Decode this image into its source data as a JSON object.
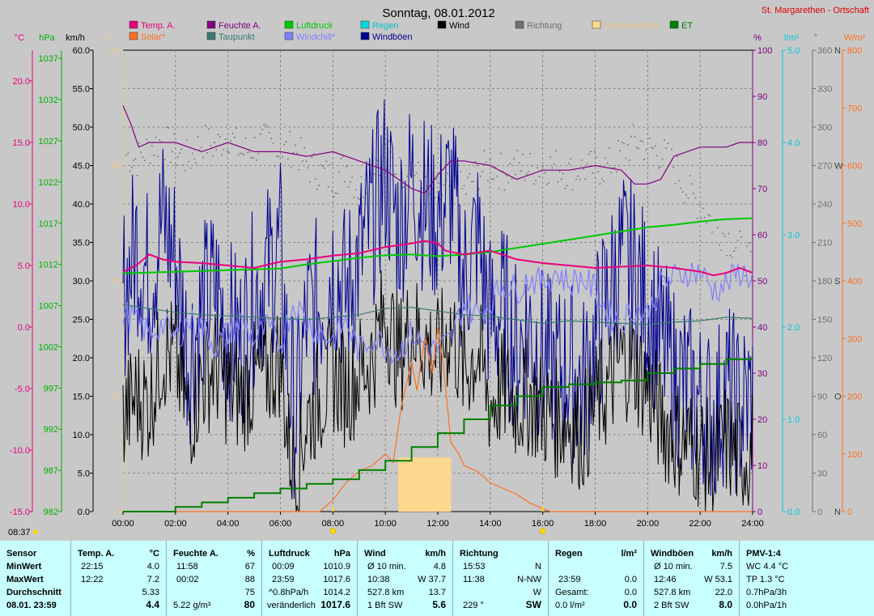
{
  "header": {
    "title": "Sonntag, 08.01.2012",
    "location": "St. Margarethen - Ortschaft",
    "sunrise_time": "08:37"
  },
  "legend": [
    {
      "label": "Temp. A.",
      "color": "#e8007a"
    },
    {
      "label": "Feuchte A.",
      "color": "#800080"
    },
    {
      "label": "Luftdruck",
      "color": "#00c800"
    },
    {
      "label": "Regen",
      "color": "#00d8e0"
    },
    {
      "label": "Wind",
      "color": "#000000"
    },
    {
      "label": "Richtung",
      "color": "#707070"
    },
    {
      "label": "Sonnenschein",
      "color": "#ffd890"
    },
    {
      "label": "ET",
      "color": "#008000"
    },
    {
      "label": "Solar*",
      "color": "#ff7020"
    },
    {
      "label": "Taupunkt",
      "color": "#3a7a70"
    },
    {
      "label": "Windchill*",
      "color": "#8080ff"
    },
    {
      "label": "Windböen",
      "color": "#000090"
    }
  ],
  "axes": {
    "temp": {
      "unit": "°C",
      "ticks": [
        "20.0",
        "15.0",
        "10.0",
        "5.0",
        "0.0",
        "-5.0",
        "-10.0",
        "-15.0"
      ]
    },
    "pressure": {
      "unit": "hPa",
      "ticks": [
        "1037",
        "1032",
        "1027",
        "1022",
        "1017",
        "1012",
        "1007",
        "1002",
        "997",
        "992",
        "987",
        "982"
      ]
    },
    "wind": {
      "unit": "km/h",
      "ticks": [
        "60.0",
        "55.0",
        "50.0",
        "45.0",
        "40.0",
        "35.0",
        "30.0",
        "25.0",
        "20.0",
        "15.0",
        "10.0",
        "5.0",
        "0.0"
      ]
    },
    "sun": {
      "unit": "h",
      "ticks": [
        "60",
        "45",
        "30",
        "15",
        "0"
      ]
    },
    "humidity": {
      "unit": "%",
      "ticks": [
        "100",
        "90",
        "80",
        "70",
        "60",
        "50",
        "40",
        "30",
        "20",
        "10",
        "0"
      ]
    },
    "rain": {
      "unit": "l/m²",
      "ticks": [
        "5.0",
        "4.0",
        "3.0",
        "2.0",
        "1.0",
        "0.0"
      ]
    },
    "direction": {
      "unit": "°",
      "ticks": [
        "360",
        "330",
        "300",
        "270",
        "240",
        "210",
        "180",
        "150",
        "120",
        "90",
        "60",
        "30",
        "0"
      ],
      "compass": [
        "N",
        "",
        "",
        "W",
        "",
        "",
        "S",
        "",
        "",
        "O",
        "",
        "",
        "N"
      ]
    },
    "solar": {
      "unit": "W/m²",
      "ticks": [
        "800",
        "700",
        "600",
        "500",
        "400",
        "300",
        "200",
        "100",
        "0"
      ]
    },
    "x_ticks": [
      "00:00",
      "02:00",
      "04:00",
      "06:00",
      "08:00",
      "10:00",
      "12:00",
      "14:00",
      "16:00",
      "18:00",
      "20:00",
      "22:00",
      "24:00"
    ]
  },
  "chart_data": {
    "type": "line",
    "x_unit": "hours",
    "xlim": [
      0,
      24
    ],
    "grid": true,
    "legend_position": "top",
    "series": [
      {
        "name": "Temp. A.",
        "axis": "temp",
        "color": "#e8007a",
        "x": [
          0,
          0.5,
          1,
          1.5,
          2,
          3,
          4,
          5,
          6,
          7,
          8,
          9,
          10,
          11,
          11.5,
          12,
          12.3,
          13,
          14,
          15,
          16,
          17,
          18,
          19,
          20,
          21,
          22,
          22.5,
          23,
          23.5,
          24
        ],
        "y": [
          4.5,
          5.0,
          5.9,
          5.5,
          5.3,
          5.2,
          5.0,
          4.8,
          5.3,
          5.5,
          5.8,
          6.0,
          6.5,
          6.8,
          7.0,
          6.8,
          6.2,
          5.9,
          6.2,
          5.5,
          5.2,
          5.0,
          4.8,
          4.9,
          5.0,
          4.8,
          4.5,
          4.2,
          4.4,
          4.8,
          4.4
        ]
      },
      {
        "name": "Feuchte A.",
        "axis": "humidity",
        "color": "#800080",
        "x": [
          0,
          0.3,
          0.6,
          1,
          2,
          3,
          4,
          5,
          6,
          7,
          8,
          9,
          10,
          10.5,
          11,
          11.5,
          12,
          12.5,
          13,
          14,
          15,
          16,
          17,
          18,
          19,
          19.5,
          20,
          20.5,
          21,
          22,
          23,
          23.5,
          24
        ],
        "y": [
          88,
          84,
          79,
          80,
          80,
          78,
          80,
          78,
          78,
          77,
          78,
          76,
          74,
          72,
          70,
          69,
          73,
          76,
          76,
          75,
          72,
          74,
          74,
          75,
          74,
          71,
          71,
          72,
          77,
          79,
          79,
          80,
          80
        ]
      },
      {
        "name": "Luftdruck",
        "axis": "pressure",
        "color": "#00c800",
        "x": [
          0,
          1,
          2,
          3,
          4,
          5,
          6,
          7,
          8,
          9,
          10,
          11,
          12,
          13,
          14,
          15,
          16,
          17,
          18,
          19,
          20,
          21,
          22,
          23,
          24
        ],
        "y": [
          1010.9,
          1011.0,
          1011.1,
          1011.2,
          1011.3,
          1011.4,
          1011.5,
          1012.0,
          1012.4,
          1012.8,
          1013.1,
          1013.2,
          1013.0,
          1013.2,
          1013.5,
          1014.0,
          1014.5,
          1015.0,
          1015.5,
          1016.0,
          1016.5,
          1016.8,
          1017.2,
          1017.5,
          1017.6
        ]
      },
      {
        "name": "Taupunkt",
        "axis": "temp",
        "color": "#3a7a70",
        "x": [
          0,
          1,
          2,
          3,
          4,
          5,
          6,
          7,
          8,
          9,
          10,
          11,
          12,
          13,
          14,
          15,
          16,
          17,
          18,
          19,
          20,
          21,
          22,
          23,
          24
        ],
        "y": [
          1.8,
          1.5,
          1.2,
          1.0,
          0.9,
          0.8,
          0.7,
          0.6,
          0.8,
          1.0,
          1.5,
          1.6,
          1.3,
          1.0,
          0.9,
          0.6,
          0.3,
          0.5,
          0.4,
          0.3,
          0.2,
          0.4,
          0.5,
          0.8,
          0.7
        ]
      },
      {
        "name": "Windchill*",
        "axis": "temp",
        "color": "#8080ff",
        "x": [
          0,
          0.5,
          1,
          1.5,
          2,
          2.5,
          3,
          3.5,
          4,
          4.5,
          5,
          5.5,
          6,
          6.5,
          7,
          7.5,
          8,
          8.5,
          9,
          9.5,
          10,
          10.5,
          11,
          11.5,
          12,
          12.5,
          13,
          13.5,
          14,
          14.5,
          15,
          15.5,
          16,
          16.5,
          17,
          17.5,
          18,
          18.5,
          19,
          19.5,
          20,
          20.5,
          21,
          21.5,
          22,
          22.5,
          23,
          23.5,
          24
        ],
        "y": [
          1.2,
          0.5,
          -0.5,
          0.2,
          -1.0,
          0.5,
          0.0,
          -1.5,
          -0.5,
          0.5,
          -1.0,
          0.0,
          -1.5,
          2.0,
          0.5,
          -0.5,
          -1.0,
          0.5,
          -2.0,
          -0.8,
          -1.5,
          -2.0,
          -0.5,
          -1.5,
          -2.0,
          -1.0,
          2.0,
          1.0,
          2.0,
          3.5,
          3.0,
          4.0,
          3.5,
          4.5,
          3.5,
          4.0,
          3.0,
          1.0,
          0.5,
          1.5,
          1.0,
          3.5,
          4.0,
          4.5,
          4.5,
          3.0,
          3.5,
          4.5,
          4.0
        ]
      },
      {
        "name": "Solar*",
        "axis": "solar",
        "color": "#ff7020",
        "x": [
          0,
          7.5,
          8,
          8.5,
          9,
          9.5,
          10,
          10.3,
          10.6,
          11,
          11.2,
          11.5,
          11.8,
          12,
          12.2,
          12.5,
          12.8,
          13,
          13.5,
          14,
          14.5,
          15,
          15.5,
          16,
          16.3,
          16.8,
          24
        ],
        "y": [
          0,
          0,
          20,
          50,
          70,
          80,
          100,
          85,
          180,
          260,
          210,
          300,
          240,
          320,
          260,
          120,
          100,
          80,
          70,
          50,
          40,
          30,
          15,
          5,
          0,
          0,
          0
        ]
      },
      {
        "name": "ET",
        "axis": "rain",
        "color": "#008000",
        "step": true,
        "x": [
          0,
          1,
          2,
          3,
          4,
          5,
          6,
          7,
          8,
          9,
          10,
          11,
          12,
          13,
          14,
          15,
          16,
          17,
          18,
          19,
          20,
          21,
          22,
          23,
          24
        ],
        "y": [
          0,
          0,
          0.05,
          0.1,
          0.15,
          0.2,
          0.25,
          0.3,
          0.35,
          0.45,
          0.55,
          0.7,
          0.85,
          1.0,
          1.15,
          1.25,
          1.35,
          1.38,
          1.4,
          1.42,
          1.5,
          1.55,
          1.6,
          1.65,
          1.65
        ]
      },
      {
        "name": "Sonnenschein",
        "axis": "sun",
        "color": "#ffd890",
        "type": "bar",
        "x": [
          10.5,
          11.5,
          12.5
        ],
        "y": [
          7,
          7,
          0
        ]
      },
      {
        "name": "Wind",
        "axis": "wind",
        "color": "#000000",
        "x": [
          0,
          0.5,
          1,
          1.5,
          2,
          2.5,
          3,
          3.5,
          4,
          4.5,
          5,
          5.5,
          6,
          6.3,
          6.6,
          7,
          7.5,
          8,
          8.5,
          9,
          9.5,
          10,
          10.5,
          11,
          11.5,
          12,
          12.5,
          13,
          13.5,
          14,
          14.5,
          15,
          15.5,
          16,
          16.5,
          17,
          17.5,
          18,
          18.5,
          19,
          19.5,
          20,
          20.5,
          21,
          21.5,
          22,
          22.5,
          23,
          23.5,
          24
        ],
        "y": [
          12,
          15,
          14,
          21,
          20,
          12,
          17,
          19,
          16,
          15,
          17,
          18,
          20,
          9,
          5,
          12,
          15,
          18,
          16,
          18,
          20,
          26,
          20,
          24,
          22,
          20,
          24,
          18,
          21,
          14,
          16,
          14,
          15,
          13,
          12,
          12,
          10,
          14,
          16,
          20,
          19,
          16,
          12,
          10,
          9,
          8,
          6,
          9,
          7,
          8
        ],
        "spread": 8
      },
      {
        "name": "Windböen",
        "axis": "wind",
        "color": "#000090",
        "x": [
          0,
          0.5,
          1,
          1.5,
          2,
          2.5,
          3,
          3.5,
          4,
          4.5,
          5,
          5.5,
          6,
          6.3,
          6.6,
          7,
          7.5,
          8,
          8.5,
          9,
          9.5,
          10,
          10.5,
          11,
          11.5,
          12,
          12.5,
          13,
          13.5,
          14,
          14.5,
          15,
          15.5,
          16,
          16.5,
          17,
          17.5,
          18,
          18.5,
          19,
          19.5,
          20,
          20.5,
          21,
          21.5,
          22,
          22.5,
          23,
          23.5,
          24
        ],
        "y": [
          28,
          35,
          30,
          38,
          33,
          20,
          26,
          29,
          24,
          22,
          28,
          31,
          34,
          18,
          12,
          25,
          27,
          32,
          28,
          33,
          38,
          44,
          37,
          43,
          40,
          38,
          42,
          30,
          36,
          25,
          26,
          21,
          24,
          20,
          18,
          19,
          16,
          22,
          28,
          33,
          31,
          27,
          22,
          18,
          16,
          14,
          12,
          16,
          13,
          15
        ],
        "spread": 12
      },
      {
        "name": "Richtung",
        "axis": "direction",
        "color": "#707070",
        "type": "scatter",
        "x": [
          0,
          0.5,
          1,
          1.5,
          2,
          2.5,
          3,
          3.5,
          4,
          4.5,
          5,
          5.5,
          6,
          6.5,
          7,
          7.5,
          8,
          8.5,
          9,
          9.5,
          10,
          10.5,
          11,
          11.5,
          12,
          12.5,
          13,
          13.5,
          14,
          14.5,
          15,
          15.5,
          16,
          16.5,
          17,
          17.5,
          18,
          18.5,
          19,
          19.5,
          20,
          20.5,
          21,
          21.5,
          22,
          22.5,
          23,
          23.5,
          24
        ],
        "y": [
          280,
          275,
          285,
          290,
          280,
          275,
          290,
          285,
          295,
          280,
          285,
          290,
          280,
          285,
          270,
          265,
          260,
          270,
          250,
          275,
          280,
          265,
          270,
          250,
          245,
          255,
          250,
          265,
          270,
          265,
          270,
          268,
          270,
          270,
          265,
          268,
          268,
          270,
          280,
          290,
          285,
          280,
          270,
          250,
          240,
          225,
          215,
          205,
          190
        ]
      }
    ]
  },
  "sun_markers": {
    "sunrise": "08:00",
    "sunset": "16:00"
  },
  "stats": {
    "row_labels": [
      "Sensor",
      "MinWert",
      "MaxWert",
      "Durchschnitt",
      "08.01. 23:59"
    ],
    "temp": {
      "header": "Temp. A.",
      "unit": "°C",
      "min_time": "22:15",
      "min": "4.0",
      "max_time": "12:22",
      "max": "7.2",
      "avg": "5.33",
      "cur": "4.4"
    },
    "hum": {
      "header": "Feuchte A.",
      "unit": "%",
      "min_time": "11:58",
      "min": "67",
      "max_time": "00:02",
      "max": "88",
      "avg": "75",
      "cur_abs": "5.22 g/m³",
      "cur": "80"
    },
    "press": {
      "header": "Luftdruck",
      "unit": "hPa",
      "min_time": "00:09",
      "min": "1010.9",
      "max_time": "23:59",
      "max": "1017.6",
      "avg_trend": "^0.8hPa/h",
      "avg": "1014.2",
      "cur_text": "veränderlich",
      "cur": "1017.6"
    },
    "wind": {
      "header": "Wind",
      "unit": "km/h",
      "r1_label": "Ø 10 min.",
      "r1_val": "4.8",
      "r2_time": "10:38",
      "r2_val": "W 37.7",
      "r3_label": "527.8 km",
      "r3_val": "13.7",
      "r4_label": "1 Bft SW",
      "r4_val": "5.6"
    },
    "dir": {
      "header": "Richtung",
      "r1_time": "15:53",
      "r1_val": "N",
      "r2_time": "11:38",
      "r2_val": "N-NW",
      "r3_val": "W",
      "r4_label": "229 °",
      "r4_val": "SW"
    },
    "rain": {
      "header": "Regen",
      "unit": "l/m²",
      "r2_time": "23:59",
      "r2_val": "0.0",
      "r3_label": "Gesamt:",
      "r3_val": "0.0",
      "r4_label": "0.0 l/m²",
      "r4_val": "0.0"
    },
    "gust": {
      "header": "Windböen",
      "unit": "km/h",
      "r1_label": "Ø 10 min.",
      "r1_val": "7.5",
      "r2_time": "12:46",
      "r2_val": "W 53.1",
      "r3_label": "527.8 km",
      "r3_val": "22.0",
      "r4_label": "2 Bft SW",
      "r4_val": "8.0"
    },
    "pmv": {
      "header": "PMV-1:4",
      "r1": "WC 4.4 °C",
      "r2": "TP 1.3 °C",
      "r3": "0.7hPa/3h",
      "r4": "0.0hPa/1h"
    }
  }
}
